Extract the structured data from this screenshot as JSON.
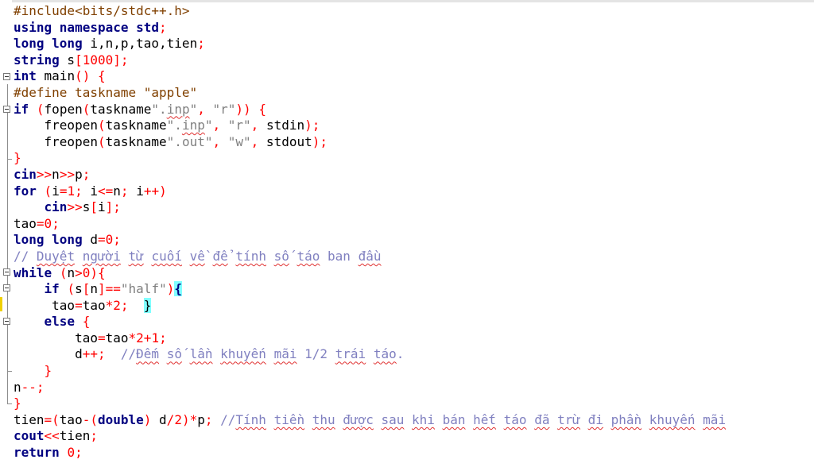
{
  "editor": {
    "lines": [
      [
        [
          "pp",
          "#include<bits/stdc++.h>"
        ]
      ],
      [
        [
          "kw",
          "using namespace std"
        ],
        [
          "op",
          ";"
        ]
      ],
      [
        [
          "kw",
          "long long"
        ],
        [
          "",
          " i,n,p,tao,tien"
        ],
        [
          "op",
          ";"
        ]
      ],
      [
        [
          "kw",
          "string"
        ],
        [
          "",
          " s"
        ],
        [
          "op",
          "["
        ],
        [
          "num",
          "1000"
        ],
        [
          "op",
          "];"
        ]
      ],
      [
        [
          "kw",
          "int"
        ],
        [
          "",
          " main"
        ],
        [
          "op",
          "() {"
        ]
      ],
      [
        [
          "pp",
          "#define taskname \"apple\""
        ]
      ],
      [
        [
          "kw",
          "if"
        ],
        [
          "",
          " "
        ],
        [
          "op",
          "("
        ],
        [
          "",
          "fopen"
        ],
        [
          "op",
          "("
        ],
        [
          "",
          "taskname"
        ],
        [
          "str",
          "\"."
        ],
        [
          "str sq",
          "inp"
        ],
        [
          "str",
          "\""
        ],
        [
          "op",
          ","
        ],
        [
          "",
          " "
        ],
        [
          "str",
          "\"r\""
        ],
        [
          "op",
          ")) {"
        ]
      ],
      [
        [
          "",
          "    freopen"
        ],
        [
          "op",
          "("
        ],
        [
          "",
          "taskname"
        ],
        [
          "str",
          "\"."
        ],
        [
          "str sq",
          "inp"
        ],
        [
          "str",
          "\""
        ],
        [
          "op",
          ","
        ],
        [
          "",
          " "
        ],
        [
          "str",
          "\"r\""
        ],
        [
          "op",
          ","
        ],
        [
          "",
          " stdin"
        ],
        [
          "op",
          ");"
        ]
      ],
      [
        [
          "",
          "    freopen"
        ],
        [
          "op",
          "("
        ],
        [
          "",
          "taskname"
        ],
        [
          "str",
          "\".out\""
        ],
        [
          "op",
          ","
        ],
        [
          "",
          " "
        ],
        [
          "str",
          "\"w\""
        ],
        [
          "op",
          ","
        ],
        [
          "",
          " stdout"
        ],
        [
          "op",
          ");"
        ]
      ],
      [
        [
          "op",
          "}"
        ]
      ],
      [
        [
          "kw",
          "cin"
        ],
        [
          "op",
          ">>"
        ],
        [
          "",
          "n"
        ],
        [
          "op",
          ">>"
        ],
        [
          "",
          "p"
        ],
        [
          "op",
          ";"
        ]
      ],
      [
        [
          "kw",
          "for"
        ],
        [
          "",
          " "
        ],
        [
          "op",
          "("
        ],
        [
          "",
          "i"
        ],
        [
          "op",
          "="
        ],
        [
          "num",
          "1"
        ],
        [
          "op",
          ";"
        ],
        [
          "",
          " i"
        ],
        [
          "op",
          "<="
        ],
        [
          "",
          "n"
        ],
        [
          "op",
          ";"
        ],
        [
          "",
          " i"
        ],
        [
          "op",
          "++)"
        ]
      ],
      [
        [
          "",
          "    "
        ],
        [
          "kw",
          "cin"
        ],
        [
          "op",
          ">>"
        ],
        [
          "",
          "s"
        ],
        [
          "op",
          "["
        ],
        [
          "",
          "i"
        ],
        [
          "op",
          "];"
        ]
      ],
      [
        [
          "",
          "tao"
        ],
        [
          "op",
          "="
        ],
        [
          "num",
          "0"
        ],
        [
          "op",
          ";"
        ]
      ],
      [
        [
          "kw",
          "long long"
        ],
        [
          "",
          " d"
        ],
        [
          "op",
          "="
        ],
        [
          "num",
          "0"
        ],
        [
          "op",
          ";"
        ]
      ],
      [
        [
          "cm",
          "// "
        ],
        [
          "cm sq",
          "Duyệt"
        ],
        [
          "cm",
          " "
        ],
        [
          "cm sq",
          "người"
        ],
        [
          "cm",
          " "
        ],
        [
          "cm sq",
          "từ"
        ],
        [
          "cm",
          " "
        ],
        [
          "cm sq",
          "cuối"
        ],
        [
          "cm",
          " "
        ],
        [
          "cm sq",
          "về"
        ],
        [
          "cm",
          " "
        ],
        [
          "cm sq",
          "để"
        ],
        [
          "cm",
          " "
        ],
        [
          "cm sq",
          "tính"
        ],
        [
          "cm",
          " "
        ],
        [
          "cm sq",
          "số"
        ],
        [
          "cm",
          " "
        ],
        [
          "cm sq",
          "táo"
        ],
        [
          "cm",
          " ban "
        ],
        [
          "cm sq",
          "đầu"
        ]
      ],
      [
        [
          "kw",
          "while"
        ],
        [
          "",
          " "
        ],
        [
          "op",
          "("
        ],
        [
          "",
          "n"
        ],
        [
          "op",
          ">"
        ],
        [
          "num",
          "0"
        ],
        [
          "op",
          "){"
        ]
      ],
      [
        [
          "",
          "    "
        ],
        [
          "kw",
          "if"
        ],
        [
          "",
          " "
        ],
        [
          "op",
          "("
        ],
        [
          "",
          "s"
        ],
        [
          "op",
          "["
        ],
        [
          "",
          "n"
        ],
        [
          "op",
          "]=="
        ],
        [
          "str",
          "\"half\""
        ],
        [
          "op",
          ")"
        ],
        [
          "hl-k",
          "{"
        ]
      ],
      [
        [
          "",
          "     tao"
        ],
        [
          "op",
          "="
        ],
        [
          "",
          "tao"
        ],
        [
          "op",
          "*"
        ],
        [
          "num",
          "2"
        ],
        [
          "op",
          ";"
        ],
        [
          "",
          "  "
        ],
        [
          "hl",
          "}"
        ]
      ],
      [
        [
          "",
          "    "
        ],
        [
          "kw",
          "else"
        ],
        [
          "",
          " "
        ],
        [
          "op",
          "{"
        ]
      ],
      [
        [
          "",
          "        tao"
        ],
        [
          "op",
          "="
        ],
        [
          "",
          "tao"
        ],
        [
          "op",
          "*"
        ],
        [
          "num",
          "2"
        ],
        [
          "op",
          "+"
        ],
        [
          "num",
          "1"
        ],
        [
          "op",
          ";"
        ]
      ],
      [
        [
          "",
          "        d"
        ],
        [
          "op",
          "++;"
        ],
        [
          "",
          "  "
        ],
        [
          "cm",
          "//"
        ],
        [
          "cm sq",
          "Đếm"
        ],
        [
          "cm",
          " "
        ],
        [
          "cm sq",
          "số"
        ],
        [
          "cm",
          " "
        ],
        [
          "cm sq",
          "lần"
        ],
        [
          "cm",
          " "
        ],
        [
          "cm sq",
          "khuyến"
        ],
        [
          "cm",
          " "
        ],
        [
          "cm sq",
          "mãi"
        ],
        [
          "cm",
          " 1/2 "
        ],
        [
          "cm sq",
          "trái"
        ],
        [
          "cm",
          " "
        ],
        [
          "cm sq",
          "táo"
        ],
        [
          "cm",
          "."
        ]
      ],
      [
        [
          "",
          "    "
        ],
        [
          "op",
          "}"
        ]
      ],
      [
        [
          "",
          "n"
        ],
        [
          "op",
          "--;"
        ]
      ],
      [
        [
          "op",
          "}"
        ]
      ],
      [
        [
          "",
          "tien"
        ],
        [
          "op",
          "=("
        ],
        [
          "",
          "tao"
        ],
        [
          "op",
          "-("
        ],
        [
          "kw",
          "double"
        ],
        [
          "op",
          ")"
        ],
        [
          "",
          " d"
        ],
        [
          "op",
          "/"
        ],
        [
          "num",
          "2"
        ],
        [
          "op",
          ")*"
        ],
        [
          "",
          "p"
        ],
        [
          "op",
          ";"
        ],
        [
          "",
          " "
        ],
        [
          "cm",
          "//"
        ],
        [
          "cm sq",
          "Tính"
        ],
        [
          "cm",
          " "
        ],
        [
          "cm sq",
          "tiền"
        ],
        [
          "cm",
          " "
        ],
        [
          "cm sq",
          "thu"
        ],
        [
          "cm",
          " "
        ],
        [
          "cm sq",
          "được"
        ],
        [
          "cm",
          " "
        ],
        [
          "cm sq",
          "sau"
        ],
        [
          "cm",
          " "
        ],
        [
          "cm sq",
          "khi"
        ],
        [
          "cm",
          " "
        ],
        [
          "cm sq",
          "bán"
        ],
        [
          "cm",
          " "
        ],
        [
          "cm sq",
          "hết"
        ],
        [
          "cm",
          " "
        ],
        [
          "cm sq",
          "táo"
        ],
        [
          "cm",
          " "
        ],
        [
          "cm sq",
          "đã"
        ],
        [
          "cm",
          " "
        ],
        [
          "cm sq",
          "trừ"
        ],
        [
          "cm",
          " "
        ],
        [
          "cm sq",
          "đi"
        ],
        [
          "cm",
          " "
        ],
        [
          "cm sq",
          "phần"
        ],
        [
          "cm",
          " "
        ],
        [
          "cm sq",
          "khuyến"
        ],
        [
          "cm",
          " "
        ],
        [
          "cm sq",
          "mãi"
        ]
      ],
      [
        [
          "kw",
          "cout"
        ],
        [
          "op",
          "<<"
        ],
        [
          "",
          "tien"
        ],
        [
          "op",
          ";"
        ]
      ],
      [
        [
          "kw",
          "return"
        ],
        [
          "",
          " "
        ],
        [
          "num",
          "0"
        ],
        [
          "op",
          ";"
        ]
      ]
    ]
  }
}
